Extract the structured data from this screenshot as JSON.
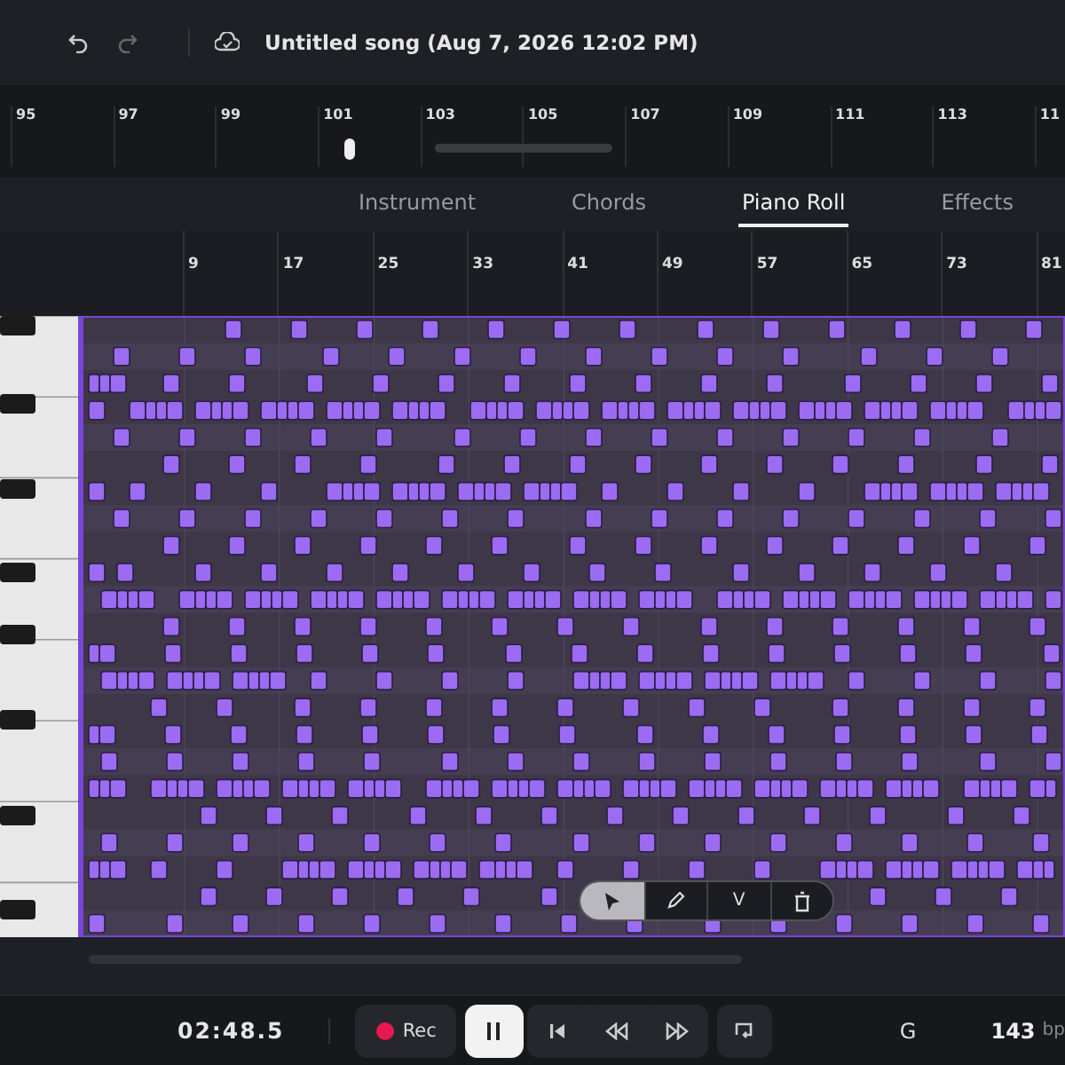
{
  "top_bar": {
    "title": "Untitled song (Aug 7, 2026 12:02 PM)",
    "undo": {
      "disabled": false
    },
    "redo": {
      "disabled": true
    }
  },
  "timeline": {
    "markers": [
      "95",
      "97",
      "99",
      "101",
      "103",
      "105",
      "107",
      "109",
      "111",
      "113",
      "11"
    ]
  },
  "tabs": [
    {
      "label": "Instrument",
      "selected": false
    },
    {
      "label": "Chords",
      "selected": false
    },
    {
      "label": "Piano Roll",
      "selected": true
    },
    {
      "label": "Effects",
      "selected": false
    }
  ],
  "piano_roll": {
    "bars": [
      "9",
      "17",
      "25",
      "33",
      "41",
      "49",
      "57",
      "65",
      "73",
      "81"
    ],
    "tools": [
      {
        "kind": "pointer",
        "selected": true
      },
      {
        "kind": "pencil",
        "selected": false
      },
      {
        "kind": "text",
        "label": "V",
        "selected": false
      },
      {
        "kind": "trash",
        "selected": false
      }
    ]
  },
  "transport": {
    "time": "02:48.5",
    "record": {
      "label": "Rec"
    },
    "playing": true,
    "key": "G",
    "tempo": "143",
    "tempo_unit": "bp"
  }
}
